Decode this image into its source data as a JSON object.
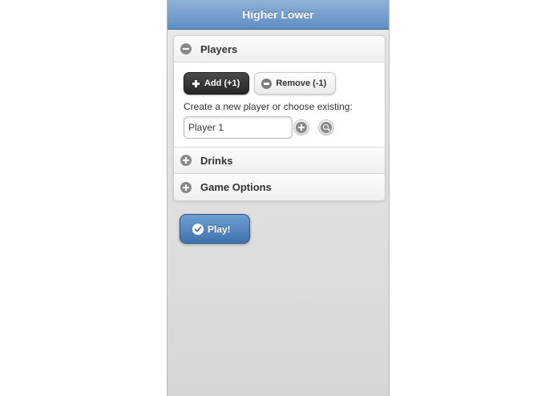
{
  "header": {
    "title": "Higher Lower"
  },
  "players": {
    "title": "Players",
    "icon": "minus-circle-icon",
    "add_label": "Add (+1)",
    "remove_label": "Remove (-1)",
    "prompt": "Create a new  player or choose existing:",
    "input_value": "Player 1"
  },
  "drinks": {
    "title": "Drinks",
    "icon": "plus-circle-icon"
  },
  "game_options": {
    "title": "Game Options",
    "icon": "plus-circle-icon"
  },
  "play": {
    "label": "Play!",
    "icon": "check-icon"
  },
  "colors": {
    "header": "#6f9bcc",
    "play_button": "#5486be",
    "dark_button": "#333333"
  }
}
